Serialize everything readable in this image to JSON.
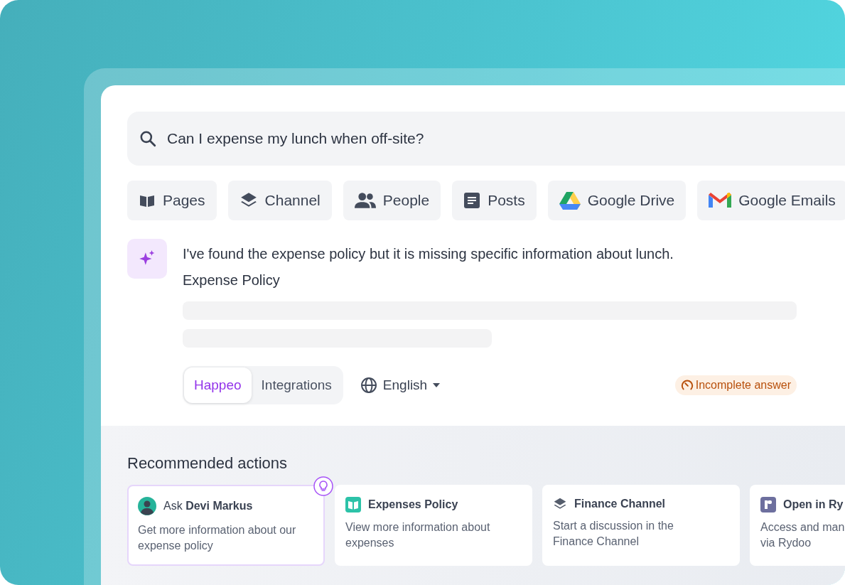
{
  "search": {
    "value": "Can I expense my lunch when off-site?"
  },
  "sources": [
    {
      "kind": "pages",
      "label": "Pages"
    },
    {
      "kind": "channel",
      "label": "Channel"
    },
    {
      "kind": "people",
      "label": "People"
    },
    {
      "kind": "posts",
      "label": "Posts"
    },
    {
      "kind": "drive",
      "label": "Google Drive"
    },
    {
      "kind": "gmail",
      "label": "Google Emails"
    }
  ],
  "answer": {
    "text": "I've found the expense policy but it is missing specific information about lunch.",
    "title": "Expense Policy"
  },
  "scope_tabs": [
    {
      "label": "Happeo",
      "selected": true
    },
    {
      "label": "Integrations",
      "selected": false
    }
  ],
  "language": {
    "label": "English"
  },
  "status": {
    "label": "Incomplete answer"
  },
  "recommended": {
    "title": "Recommended actions",
    "cards": [
      {
        "kind": "person",
        "prefix": "Ask",
        "name": "Devi Markus",
        "description": "Get more information about our\nexpense policy",
        "highlighted": true
      },
      {
        "kind": "page",
        "name": "Expenses Policy",
        "description": "View more information about\nexpenses",
        "highlighted": false
      },
      {
        "kind": "channel",
        "name": "Finance Channel",
        "description": "Start a discussion in the\nFinance Channel",
        "highlighted": false
      },
      {
        "kind": "app",
        "name": "Open in Ry",
        "description": "Access and man\nvia Rydoo",
        "highlighted": false
      }
    ]
  }
}
